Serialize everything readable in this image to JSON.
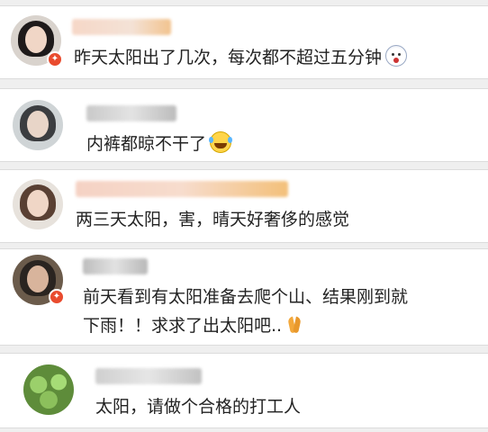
{
  "comments": [
    {
      "text": "昨天太阳出了几次，每次都不超过五分钟",
      "emoji": "fearful-face-icon",
      "verified": true
    },
    {
      "text": "内裤都晾不干了",
      "emoji": "laugh-cry-face-icon",
      "verified": false
    },
    {
      "text": "两三天太阳，害，晴天好奢侈的感觉",
      "emoji": "",
      "verified": false
    },
    {
      "text_line1": "前天看到有太阳准备去爬个山、结果刚到就",
      "text_line2": "下雨！！求求了出太阳吧..",
      "emoji": "pray-hands-icon",
      "verified": true
    },
    {
      "text": "太阳，请做个合格的打工人",
      "emoji": "",
      "verified": false
    }
  ],
  "colors": {
    "badge": "#e94b2e",
    "background": "#efefef",
    "card": "#ffffff",
    "text": "#222222"
  }
}
